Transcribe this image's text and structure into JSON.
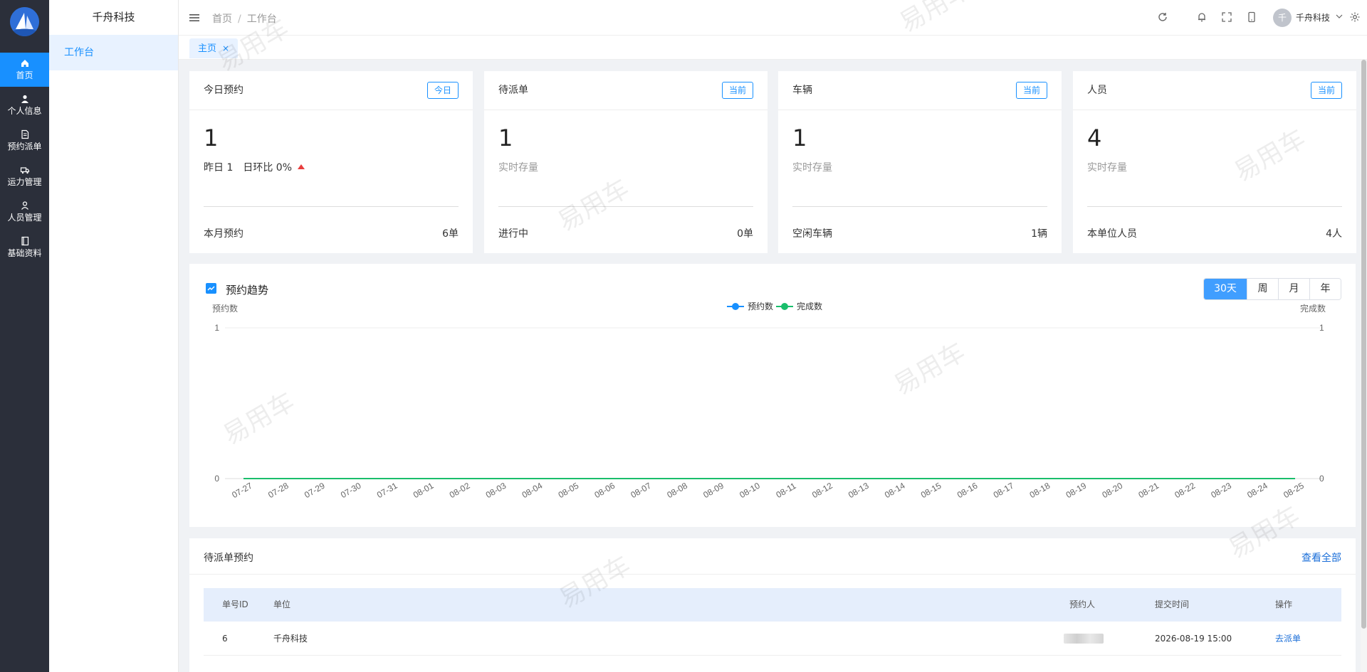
{
  "app": {
    "brand": "千舟科技",
    "rail": [
      {
        "label": "首页",
        "icon": "home-icon",
        "active": true
      },
      {
        "label": "个人信息",
        "icon": "user-icon",
        "active": false
      },
      {
        "label": "预约派单",
        "icon": "document-icon",
        "active": false
      },
      {
        "label": "运力管理",
        "icon": "truck-icon",
        "active": false
      },
      {
        "label": "人员管理",
        "icon": "person-icon",
        "active": false
      },
      {
        "label": "基础资料",
        "icon": "book-icon",
        "active": false
      }
    ],
    "submenu": [
      {
        "label": "工作台"
      }
    ]
  },
  "header": {
    "breadcrumb": [
      "首页",
      "工作台"
    ],
    "avatar_initial": "千",
    "user_name": "千舟科技"
  },
  "tabs": [
    {
      "label": "主页",
      "close": "×"
    }
  ],
  "cards": [
    {
      "title": "今日预约",
      "badge": "今日",
      "value": "1",
      "sub_a": "昨日 1",
      "sub_b": "日环比 0%",
      "footer_label": "本月预约",
      "footer_value": "6单"
    },
    {
      "title": "待派单",
      "badge": "当前",
      "value": "1",
      "sub_a": "实时存量",
      "footer_label": "进行中",
      "footer_value": "0单"
    },
    {
      "title": "车辆",
      "badge": "当前",
      "value": "1",
      "sub_a": "实时存量",
      "footer_label": "空闲车辆",
      "footer_value": "1辆"
    },
    {
      "title": "人员",
      "badge": "当前",
      "value": "4",
      "sub_a": "实时存量",
      "footer_label": "本单位人员",
      "footer_value": "4人"
    }
  ],
  "trend": {
    "title": "预约趋势",
    "ranges": [
      "30天",
      "周",
      "月",
      "年"
    ],
    "active_range": "30天"
  },
  "chart_data": {
    "type": "line",
    "title": "预约趋势",
    "ylabel": "预约数",
    "y2label": "完成数",
    "ylim": [
      0,
      1
    ],
    "y2lim": [
      0,
      1
    ],
    "grid": true,
    "legend_position": "top-center",
    "categories": [
      "07-27",
      "07-28",
      "07-29",
      "07-30",
      "07-31",
      "08-01",
      "08-02",
      "08-03",
      "08-04",
      "08-05",
      "08-06",
      "08-07",
      "08-08",
      "08-09",
      "08-10",
      "08-11",
      "08-12",
      "08-13",
      "08-14",
      "08-15",
      "08-16",
      "08-17",
      "08-18",
      "08-19",
      "08-20",
      "08-21",
      "08-22",
      "08-23",
      "08-24",
      "08-25"
    ],
    "series": [
      {
        "name": "预约数",
        "color": "#1890ff",
        "axis": "left",
        "values": [
          0,
          0,
          0,
          0,
          0,
          0,
          0,
          0,
          0,
          0,
          0,
          0,
          0,
          0,
          0,
          0,
          0,
          0,
          0,
          0,
          0,
          0,
          0,
          0,
          0,
          0,
          0,
          0,
          0,
          0
        ]
      },
      {
        "name": "完成数",
        "color": "#19be6b",
        "axis": "right",
        "values": [
          0,
          0,
          0,
          0,
          0,
          0,
          0,
          0,
          0,
          0,
          0,
          0,
          0,
          0,
          0,
          0,
          0,
          0,
          0,
          0,
          0,
          0,
          0,
          0,
          0,
          0,
          0,
          0,
          0,
          0
        ]
      }
    ]
  },
  "pending": {
    "title": "待派单预约",
    "view_all": "查看全部",
    "columns": [
      "单号ID",
      "单位",
      "预约人",
      "提交时间",
      "操作"
    ],
    "rows": [
      {
        "id": "6",
        "unit": "千舟科技",
        "submitted": "2026-08-19 15:00",
        "action": "去派单"
      }
    ]
  },
  "watermark": "易用车"
}
